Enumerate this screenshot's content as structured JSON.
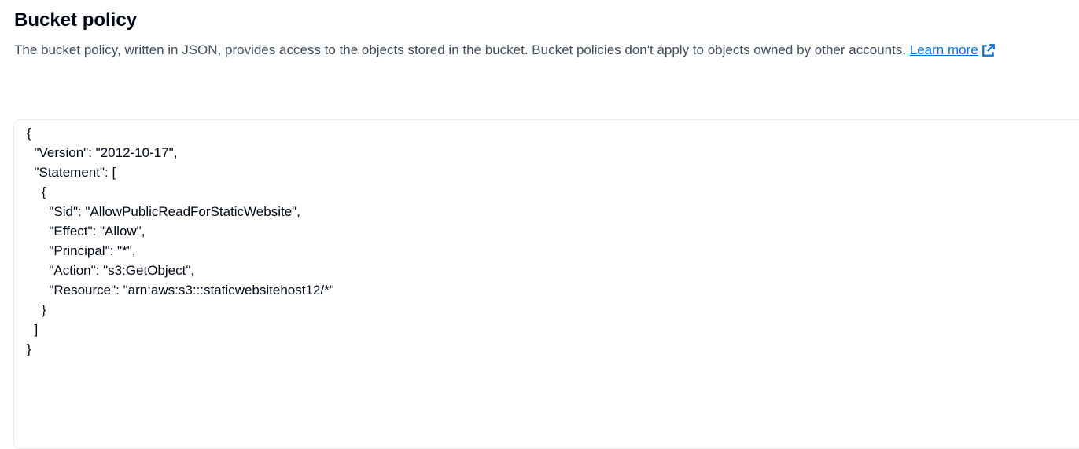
{
  "header": {
    "title": "Bucket policy",
    "description": "The bucket policy, written in JSON, provides access to the objects stored in the bucket. Bucket policies don't apply to objects owned by other accounts.",
    "learn_more_label": "Learn more",
    "link_color": "#0972d3"
  },
  "policy": {
    "text": "{\n  \"Version\": \"2012-10-17\",\n  \"Statement\": [\n    {\n      \"Sid\": \"AllowPublicReadForStaticWebsite\",\n      \"Effect\": \"Allow\",\n      \"Principal\": \"*\",\n      \"Action\": \"s3:GetObject\",\n      \"Resource\": \"arn:aws:s3:::staticwebsitehost12/*\"\n    }\n  ]\n}"
  }
}
